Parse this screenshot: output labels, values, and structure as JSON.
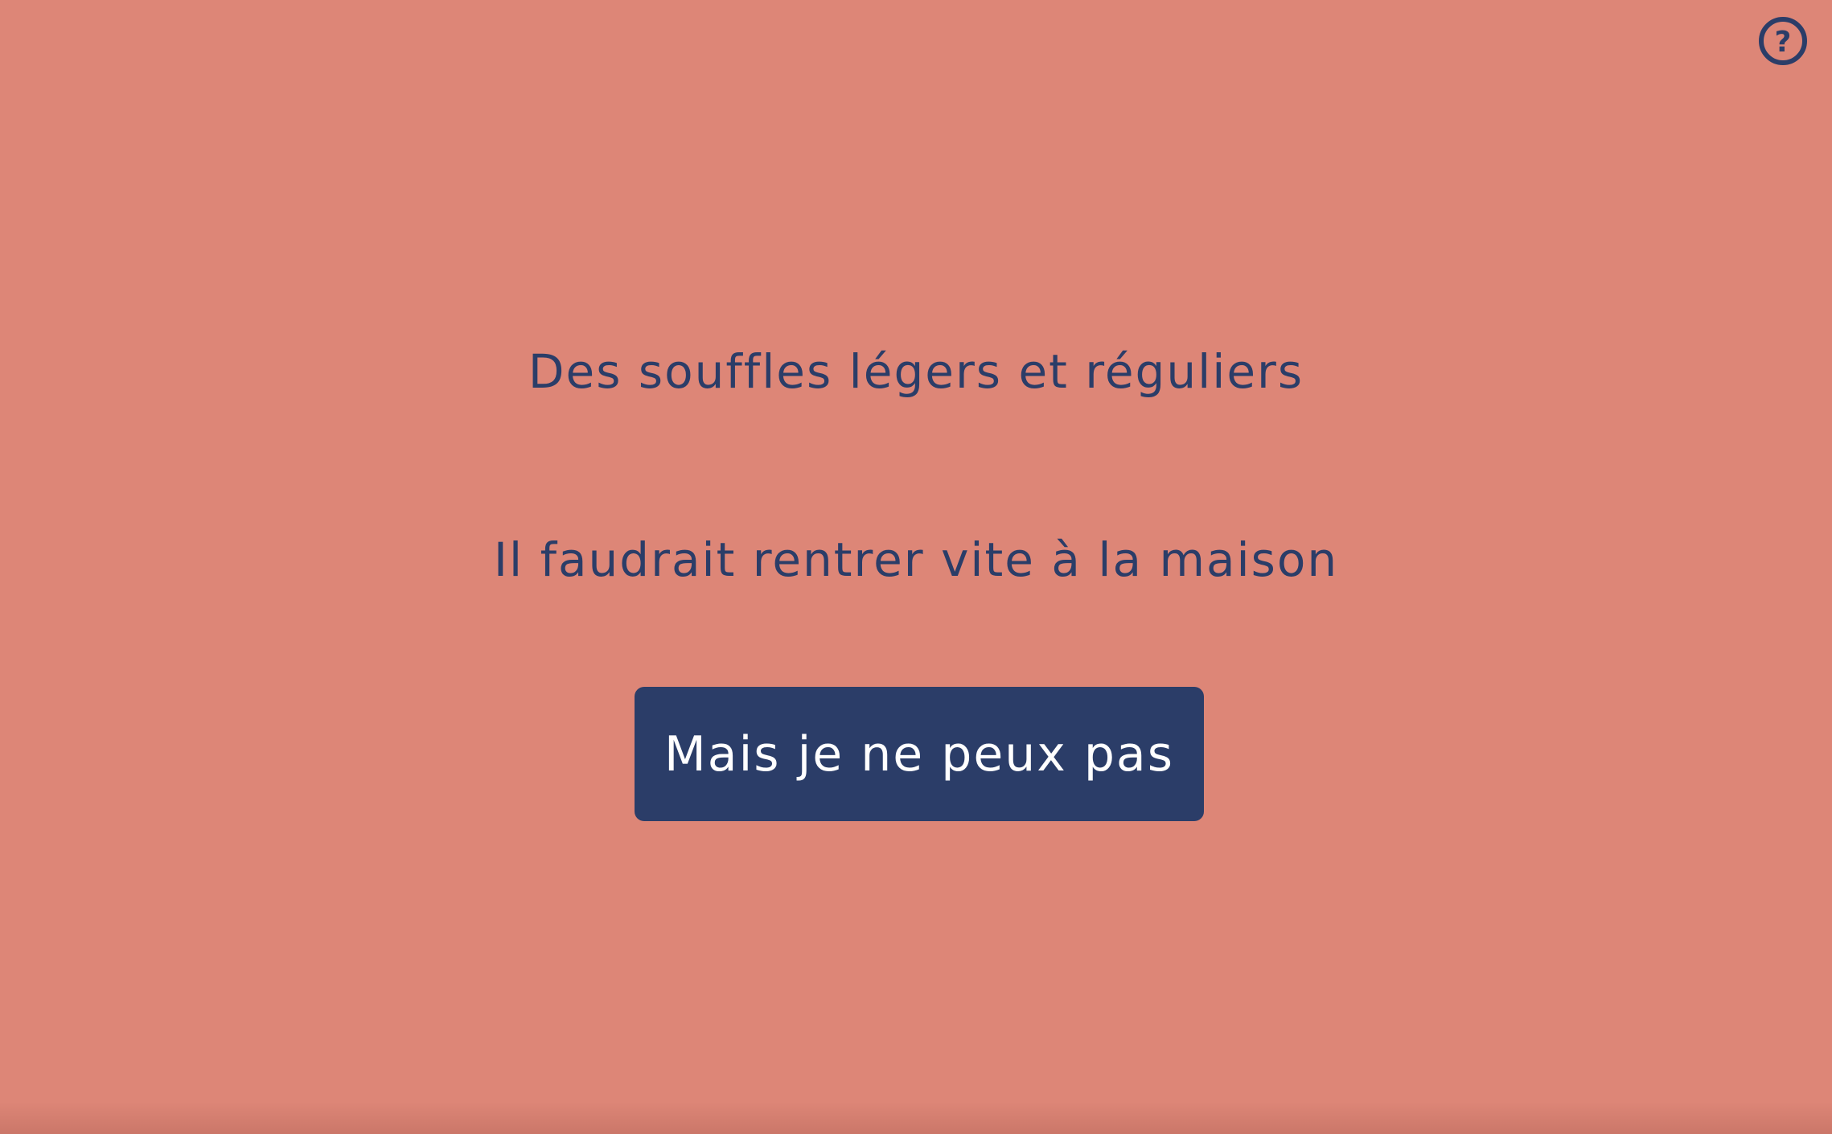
{
  "help": {
    "icon": "question-circle-icon",
    "glyph": "?"
  },
  "story": {
    "line1": "Des souffles légers et réguliers",
    "line2": "Il faudrait rentrer vite à la maison"
  },
  "action": {
    "label": "Mais je ne peux pas"
  },
  "colors": {
    "background": "#dd8677",
    "text": "#2b3d68",
    "button_bg": "#2b3d68",
    "button_text": "#ffffff"
  }
}
